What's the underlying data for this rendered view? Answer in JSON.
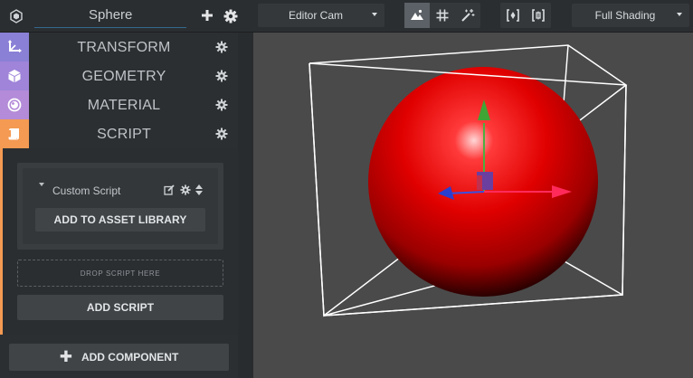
{
  "topbar": {
    "entity_name": "Sphere",
    "camera_select": "Editor Cam",
    "shading_select": "Full Shading"
  },
  "panel": {
    "sections": [
      {
        "title": "TRANSFORM"
      },
      {
        "title": "GEOMETRY"
      },
      {
        "title": "MATERIAL"
      },
      {
        "title": "SCRIPT"
      }
    ],
    "script": {
      "name": "Custom Script",
      "add_to_library_label": "ADD TO ASSET LIBRARY",
      "drop_zone_text": "DROP SCRIPT HERE",
      "add_script_label": "ADD SCRIPT"
    },
    "add_component_label": "ADD COMPONENT"
  },
  "colors": {
    "transform_tab": "#8a80d6",
    "geometry_tab": "#9f84d9",
    "material_tab": "#b38bd8",
    "script_tab": "#f49a52",
    "sphere": "#e00000"
  }
}
